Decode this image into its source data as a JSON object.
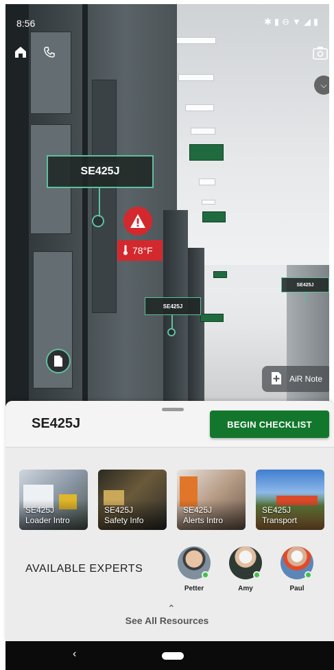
{
  "status_bar": {
    "time": "8:56",
    "icons": [
      "bluetooth-icon",
      "vibrate-icon",
      "dnd-icon",
      "wifi-icon",
      "signal-icon",
      "battery-icon"
    ]
  },
  "ar": {
    "main_label": "SE425J",
    "secondary_label": "SE425J",
    "far_label": "SE425J",
    "temperature": "78°F",
    "air_note_label": "AiR Note",
    "colors": {
      "accent": "#5fc0a0",
      "alert": "#d3282d"
    }
  },
  "sheet": {
    "asset_title": "SE425J",
    "begin_button": "BEGIN CHECKLIST",
    "resources": [
      {
        "line1": "SE425J",
        "line2": "Loader Intro"
      },
      {
        "line1": "SE425J",
        "line2": "Safety Info"
      },
      {
        "line1": "SE425J",
        "line2": "Alerts Intro"
      },
      {
        "line1": "SE425J",
        "line2": "Transport"
      }
    ],
    "experts_title": "AVAILABLE EXPERTS",
    "experts": [
      {
        "name": "Petter",
        "status": "online"
      },
      {
        "name": "Amy",
        "status": "online"
      },
      {
        "name": "Paul",
        "status": "online"
      }
    ],
    "see_all": "See All Resources",
    "colors": {
      "primary_button": "#12772c",
      "online": "#3ec34a"
    }
  }
}
